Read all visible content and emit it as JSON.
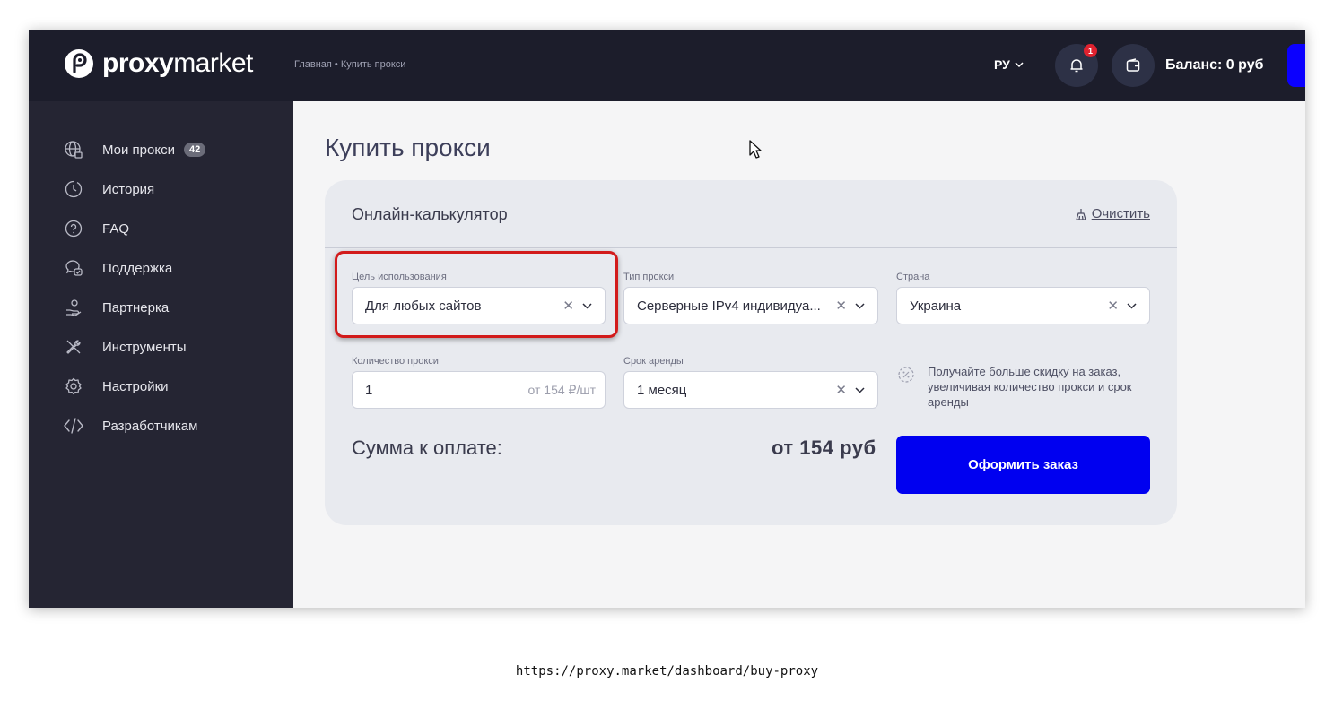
{
  "header": {
    "logo_bold": "proxy",
    "logo_light": "market",
    "breadcrumb": "Главная • Купить прокси",
    "language": "РУ",
    "notification_count": "1",
    "balance": "Баланс: 0 руб"
  },
  "sidebar": {
    "items": [
      {
        "label": "Мои прокси",
        "count": "42",
        "icon": "globe-lock-icon"
      },
      {
        "label": "История",
        "icon": "history-icon"
      },
      {
        "label": "FAQ",
        "icon": "question-icon"
      },
      {
        "label": "Поддержка",
        "icon": "support-chat-icon"
      },
      {
        "label": "Партнерка",
        "icon": "partner-icon"
      },
      {
        "label": "Инструменты",
        "icon": "tools-icon"
      },
      {
        "label": "Настройки",
        "icon": "settings-icon"
      },
      {
        "label": "Разработчикам",
        "icon": "code-icon"
      }
    ]
  },
  "main": {
    "title": "Купить прокси",
    "calculator": {
      "title": "Онлайн-калькулятор",
      "clear_label": "Очистить",
      "purpose": {
        "label": "Цель использования",
        "value": "Для любых сайтов"
      },
      "proxy_type": {
        "label": "Тип прокси",
        "value": "Серверные IPv4 индивидуа..."
      },
      "country": {
        "label": "Страна",
        "value": "Украина"
      },
      "quantity": {
        "label": "Количество прокси",
        "value": "1",
        "hint": "от 154 ₽/шт"
      },
      "term": {
        "label": "Срок аренды",
        "value": "1 месяц"
      },
      "tip": "Получайте больше скидку на заказ, увеличивая количество прокси и срок аренды",
      "sum_label": "Сумма к оплате:",
      "sum_value": "от 154 руб",
      "order_button": "Оформить заказ"
    }
  },
  "address_bar": "https://proxy.market/dashboard/buy-proxy",
  "colors": {
    "topbar": "#1c1d2b",
    "sidebar": "#252533",
    "accent_blue": "#0000f0",
    "highlight_red": "#d21b1b"
  }
}
